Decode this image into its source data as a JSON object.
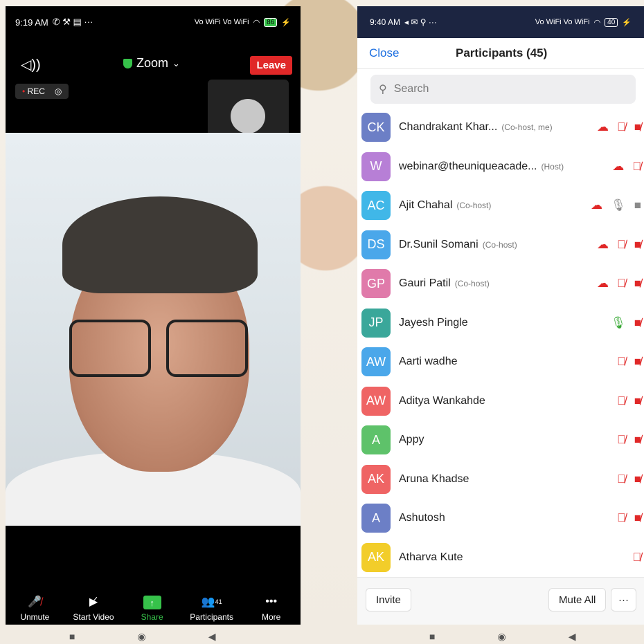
{
  "left": {
    "status": {
      "time": "9:19 AM",
      "notif": "✆ ⚒ ▤ ···",
      "signal": "Vo WiFi Vo WiFi",
      "battery": "86"
    },
    "speaker_icon": "speaker-icon",
    "title": "Zoom",
    "leave_label": "Leave",
    "rec_label": "REC",
    "toolbar": {
      "unmute": "Unmute",
      "start_video": "Start Video",
      "share": "Share",
      "participants": "Participants",
      "participants_count": "41",
      "more": "More"
    }
  },
  "right": {
    "status": {
      "time": "9:40 AM",
      "notif": "◂ ✉ ⚲ ···",
      "signal": "Vo WiFi Vo WiFi",
      "battery": "40"
    },
    "close_label": "Close",
    "title": "Participants (45)",
    "search_placeholder": "Search",
    "participants": [
      {
        "initials": "CK",
        "color": "#6c7fc6",
        "name": "Chandrakant Khar...",
        "role": "(Co-host, me)",
        "icons": [
          "cloud-red",
          "mic-off",
          "video-off"
        ]
      },
      {
        "initials": "W",
        "color": "#b77fd6",
        "name": "webinar@theuniqueacade...",
        "role": "(Host)",
        "icons": [
          "cloud-red",
          "mic-off"
        ]
      },
      {
        "initials": "AC",
        "color": "#40b7e8",
        "name": "Ajit Chahal",
        "role": "(Co-host)",
        "icons": [
          "cloud-red",
          "mic-on-gray",
          "video-on-gray"
        ]
      },
      {
        "initials": "DS",
        "color": "#4aa7ea",
        "name": "Dr.Sunil Somani",
        "role": "(Co-host)",
        "icons": [
          "cloud-red",
          "mic-off",
          "video-off"
        ]
      },
      {
        "initials": "GP",
        "color": "#e07aaa",
        "name": "Gauri Patil",
        "role": "(Co-host)",
        "icons": [
          "cloud-red",
          "mic-off",
          "video-off"
        ]
      },
      {
        "initials": "JP",
        "color": "#3aa79a",
        "name": "Jayesh Pingle",
        "role": "",
        "icons": [
          "mic-on-green",
          "video-off"
        ]
      },
      {
        "initials": "AW",
        "color": "#4aa7ea",
        "name": "Aarti wadhe",
        "role": "",
        "icons": [
          "mic-off",
          "video-off"
        ]
      },
      {
        "initials": "AW",
        "color": "#ef6464",
        "name": "Aditya Wankahde",
        "role": "",
        "icons": [
          "mic-off",
          "video-off"
        ]
      },
      {
        "initials": "A",
        "color": "#5ec26a",
        "name": "Appy",
        "role": "",
        "icons": [
          "mic-off",
          "video-off"
        ]
      },
      {
        "initials": "AK",
        "color": "#ef6464",
        "name": "Aruna Khadse",
        "role": "",
        "icons": [
          "mic-off",
          "video-off"
        ]
      },
      {
        "initials": "A",
        "color": "#6c7fc6",
        "name": "Ashutosh",
        "role": "",
        "icons": [
          "mic-off",
          "video-off"
        ]
      },
      {
        "initials": "AK",
        "color": "#f2cd2a",
        "name": "Atharva Kute",
        "role": "",
        "icons": [
          "mic-off"
        ]
      }
    ],
    "invite_label": "Invite",
    "mute_all_label": "Mute All",
    "more_label": "···"
  },
  "nav_buttons": [
    "■",
    "◉",
    "◀"
  ]
}
